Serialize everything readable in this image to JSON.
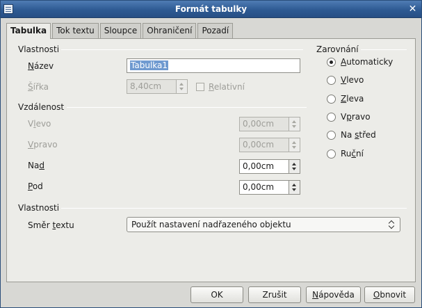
{
  "window": {
    "title": "Formát tabulky"
  },
  "tabs": [
    {
      "label": "Tabulka"
    },
    {
      "label": "Tok textu"
    },
    {
      "label": "Sloupce"
    },
    {
      "label": "Ohraničení"
    },
    {
      "label": "Pozadí"
    }
  ],
  "properties": {
    "heading": "Vlastnosti",
    "name_label_pre": "",
    "name_label_ul": "N",
    "name_label_post": "ázev",
    "name_value": "Tabulka1",
    "width_label_pre": "",
    "width_label_ul": "Š",
    "width_label_post": "ířka",
    "width_value": "8,40cm",
    "relative_label_pre": "",
    "relative_label_ul": "R",
    "relative_label_post": "elativní"
  },
  "spacing": {
    "heading": "Vzdálenost",
    "left_label_pre": "V",
    "left_label_ul": "l",
    "left_label_post": "evo",
    "left_value": "0,00cm",
    "right_label_pre": "",
    "right_label_ul": "V",
    "right_label_post": "pravo",
    "right_value": "0,00cm",
    "above_label_pre": "Na",
    "above_label_ul": "d",
    "above_label_post": "",
    "above_value": "0,00cm",
    "below_label_pre": "",
    "below_label_ul": "P",
    "below_label_post": "od",
    "below_value": "0,00cm"
  },
  "alignment": {
    "heading": "Zarovnání",
    "options": [
      {
        "pre": "",
        "ul": "A",
        "post": "utomaticky",
        "checked": true
      },
      {
        "pre": "",
        "ul": "V",
        "post": "levo",
        "checked": false
      },
      {
        "pre": "",
        "ul": "Z",
        "post": "leva",
        "checked": false
      },
      {
        "pre": "V",
        "ul": "p",
        "post": "ravo",
        "checked": false
      },
      {
        "pre": "Na ",
        "ul": "s",
        "post": "třed",
        "checked": false
      },
      {
        "pre": "Ru",
        "ul": "č",
        "post": "ní",
        "checked": false
      }
    ]
  },
  "properties2": {
    "heading": "Vlastnosti",
    "direction_label_pre": "Směr ",
    "direction_label_ul": "t",
    "direction_label_post": "extu",
    "direction_value": "Použít nastavení nadřazeného objektu"
  },
  "buttons": {
    "ok": "OK",
    "cancel": "Zrušit",
    "help_pre": "",
    "help_ul": "N",
    "help_post": "ápověda",
    "reset_pre": "",
    "reset_ul": "O",
    "reset_post": "bnovit"
  }
}
